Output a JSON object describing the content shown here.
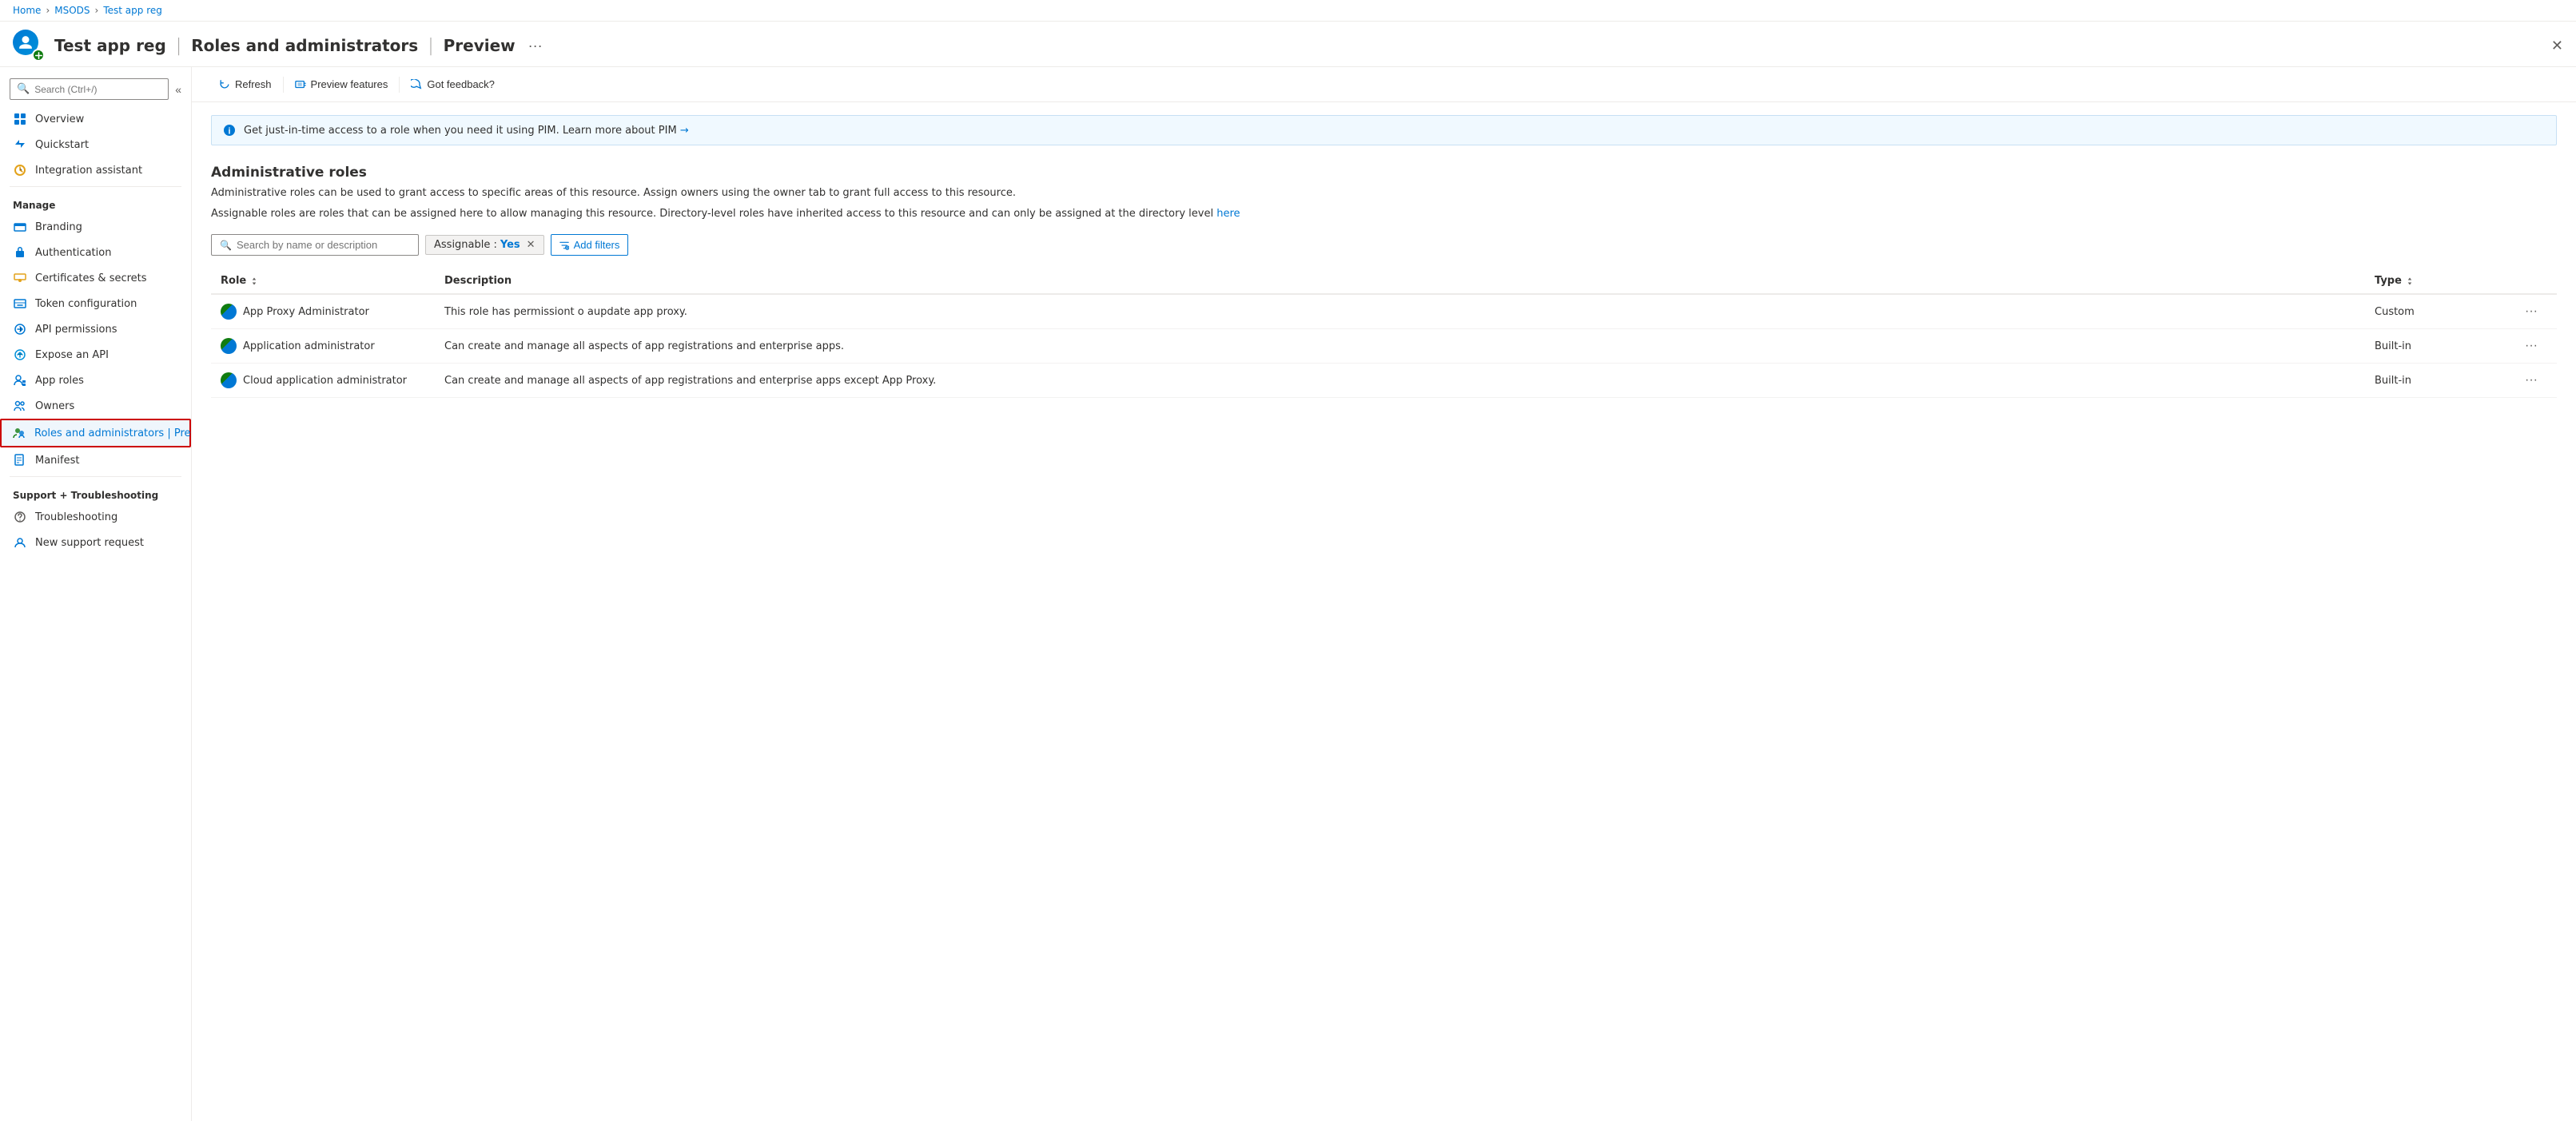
{
  "breadcrumb": {
    "home": "Home",
    "msods": "MSODS",
    "current": "Test app reg"
  },
  "header": {
    "title": "Test app reg",
    "separator1": "|",
    "subtitle": "Roles and administrators",
    "separator2": "|",
    "tag": "Preview",
    "more_label": "···",
    "close_label": "✕"
  },
  "sidebar": {
    "search_placeholder": "Search (Ctrl+/)",
    "manage_label": "Manage",
    "support_label": "Support + Troubleshooting",
    "items_top": [
      {
        "id": "overview",
        "label": "Overview"
      },
      {
        "id": "quickstart",
        "label": "Quickstart"
      },
      {
        "id": "integration",
        "label": "Integration assistant"
      }
    ],
    "items_manage": [
      {
        "id": "branding",
        "label": "Branding"
      },
      {
        "id": "authentication",
        "label": "Authentication"
      },
      {
        "id": "certificates",
        "label": "Certificates & secrets"
      },
      {
        "id": "token",
        "label": "Token configuration"
      },
      {
        "id": "api-permissions",
        "label": "API permissions"
      },
      {
        "id": "expose-api",
        "label": "Expose an API"
      },
      {
        "id": "app-roles",
        "label": "App roles"
      },
      {
        "id": "owners",
        "label": "Owners"
      },
      {
        "id": "roles-admins",
        "label": "Roles and administrators | Preview",
        "active": true
      }
    ],
    "items_manifest": [
      {
        "id": "manifest",
        "label": "Manifest"
      }
    ],
    "items_support": [
      {
        "id": "troubleshooting",
        "label": "Troubleshooting"
      },
      {
        "id": "support",
        "label": "New support request"
      }
    ]
  },
  "toolbar": {
    "refresh_label": "Refresh",
    "preview_label": "Preview features",
    "feedback_label": "Got feedback?"
  },
  "banner": {
    "text": "Get just-in-time access to a role when you need it using PIM. Learn more about PIM",
    "link_text": "→"
  },
  "content": {
    "section_title": "Administrative roles",
    "section_desc": "Administrative roles can be used to grant access to specific areas of this resource. Assign owners using the owner tab to grant full access to this resource.",
    "section_desc2_prefix": "Assignable roles are roles that can be assigned here to allow managing this resource. Directory-level roles have inherited access to this resource and can only be assigned at the directory level",
    "section_desc2_link": "here",
    "search_placeholder": "Search by name or description",
    "assignable_filter": "Assignable : ",
    "assignable_value": "Yes",
    "add_filters_label": "Add filters",
    "table": {
      "col_role": "Role",
      "col_description": "Description",
      "col_type": "Type",
      "rows": [
        {
          "role": "App Proxy Administrator",
          "description": "This role has permissiont o aupdate app proxy.",
          "type": "Custom"
        },
        {
          "role": "Application administrator",
          "description": "Can create and manage all aspects of app registrations and enterprise apps.",
          "type": "Built-in"
        },
        {
          "role": "Cloud application administrator",
          "description": "Can create and manage all aspects of app registrations and enterprise apps except App Proxy.",
          "type": "Built-in"
        }
      ]
    }
  }
}
